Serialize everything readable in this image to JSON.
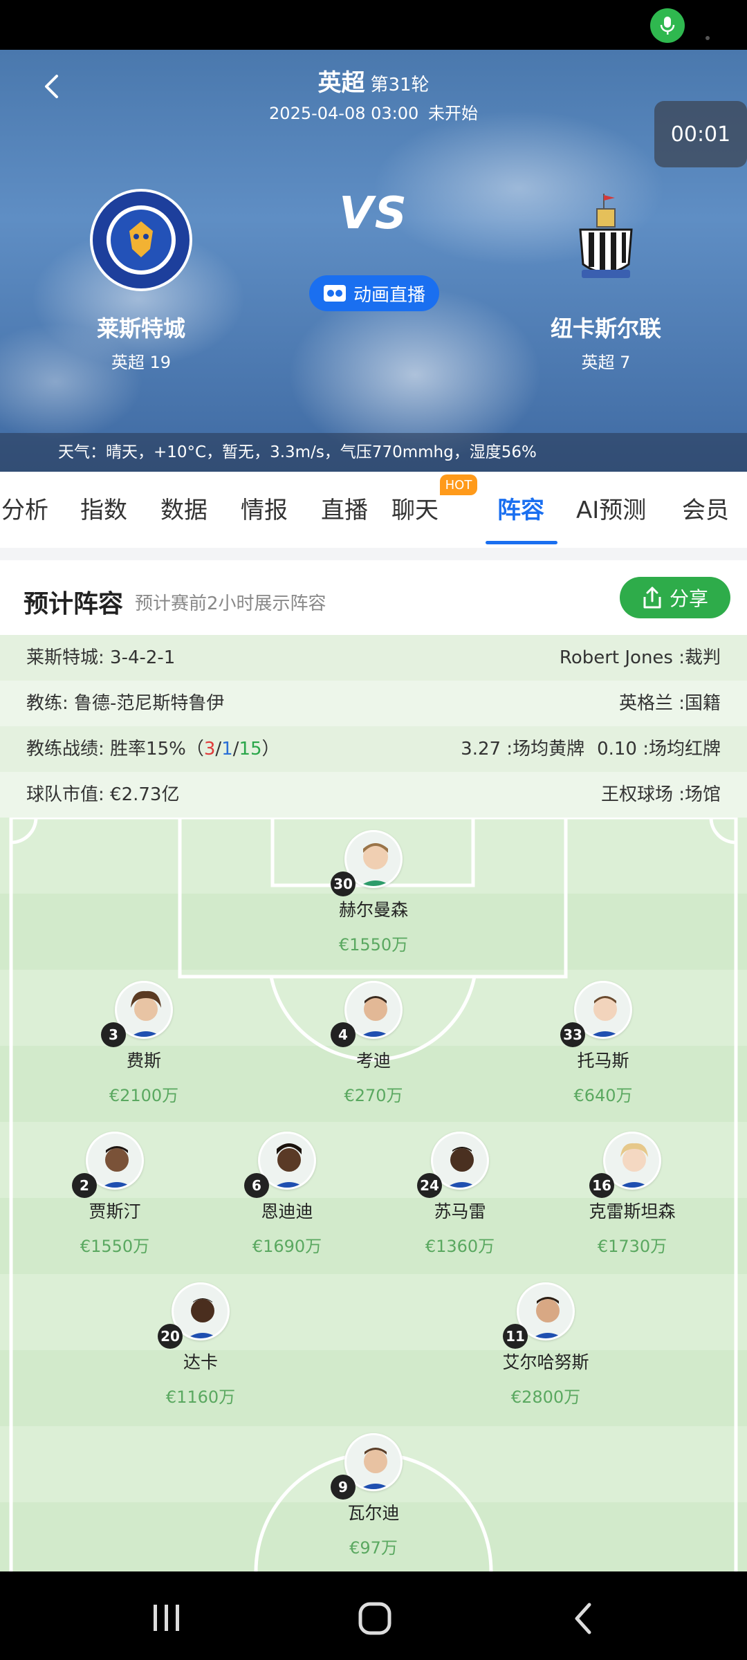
{
  "header": {
    "league": "英超",
    "round": "第31轮",
    "datetime": "2025-04-08 03:00",
    "status": "未开始",
    "timer": "00:01",
    "vs": "VS",
    "live_button": "动画直播",
    "home": {
      "name": "莱斯特城",
      "rank": "英超 19"
    },
    "away": {
      "name": "纽卡斯尔联",
      "rank": "英超 7"
    },
    "weather": "天气：晴天，+10°C，暂无，3.3m/s，气压770mmhg，湿度56%"
  },
  "tabs": {
    "items": [
      "分析",
      "指数",
      "数据",
      "情报",
      "直播",
      "聊天",
      "阵容",
      "AI预测",
      "会员"
    ],
    "hot_badge": "HOT",
    "active": "阵容"
  },
  "lineup": {
    "title": "预计阵容",
    "subtitle": "预计赛前2小时展示阵容",
    "share": "分享"
  },
  "info": {
    "formation": "莱斯特城: 3-4-2-1",
    "referee": "Robert Jones :裁判",
    "coach": "教练: 鲁德-范尼斯特鲁伊",
    "nationality": "英格兰 :国籍",
    "record_prefix": "教练战绩: 胜率15%（",
    "record_w": "3",
    "record_d": "1",
    "record_l": "15",
    "record_suffix": "）",
    "sep": "/",
    "yellow": "3.27 :场均黄牌",
    "red": "0.10 :场均红牌",
    "market_value": "球队市值: €2.73亿",
    "stadium": "王权球场 :场馆"
  },
  "players": [
    {
      "number": "30",
      "name": "赫尔曼森",
      "value": "€1550万"
    },
    {
      "number": "3",
      "name": "费斯",
      "value": "€2100万"
    },
    {
      "number": "4",
      "name": "考迪",
      "value": "€270万"
    },
    {
      "number": "33",
      "name": "托马斯",
      "value": "€640万"
    },
    {
      "number": "2",
      "name": "贾斯汀",
      "value": "€1550万"
    },
    {
      "number": "6",
      "name": "恩迪迪",
      "value": "€1690万"
    },
    {
      "number": "24",
      "name": "苏马雷",
      "value": "€1360万"
    },
    {
      "number": "16",
      "name": "克雷斯坦森",
      "value": "€1730万"
    },
    {
      "number": "20",
      "name": "达卡",
      "value": "€1160万"
    },
    {
      "number": "11",
      "name": "艾尔哈努斯",
      "value": "€2800万"
    },
    {
      "number": "9",
      "name": "瓦尔迪",
      "value": "€97万"
    }
  ],
  "colors": {
    "accent": "#1a6ff0",
    "share_green": "#2eac4a",
    "hot": "#ff9a1a",
    "value_green": "#5aa860"
  },
  "icons": [
    "back-arrow-icon",
    "mic-icon",
    "video-icon",
    "share-icon",
    "nav-recents-icon",
    "nav-home-icon",
    "nav-back-icon"
  ]
}
